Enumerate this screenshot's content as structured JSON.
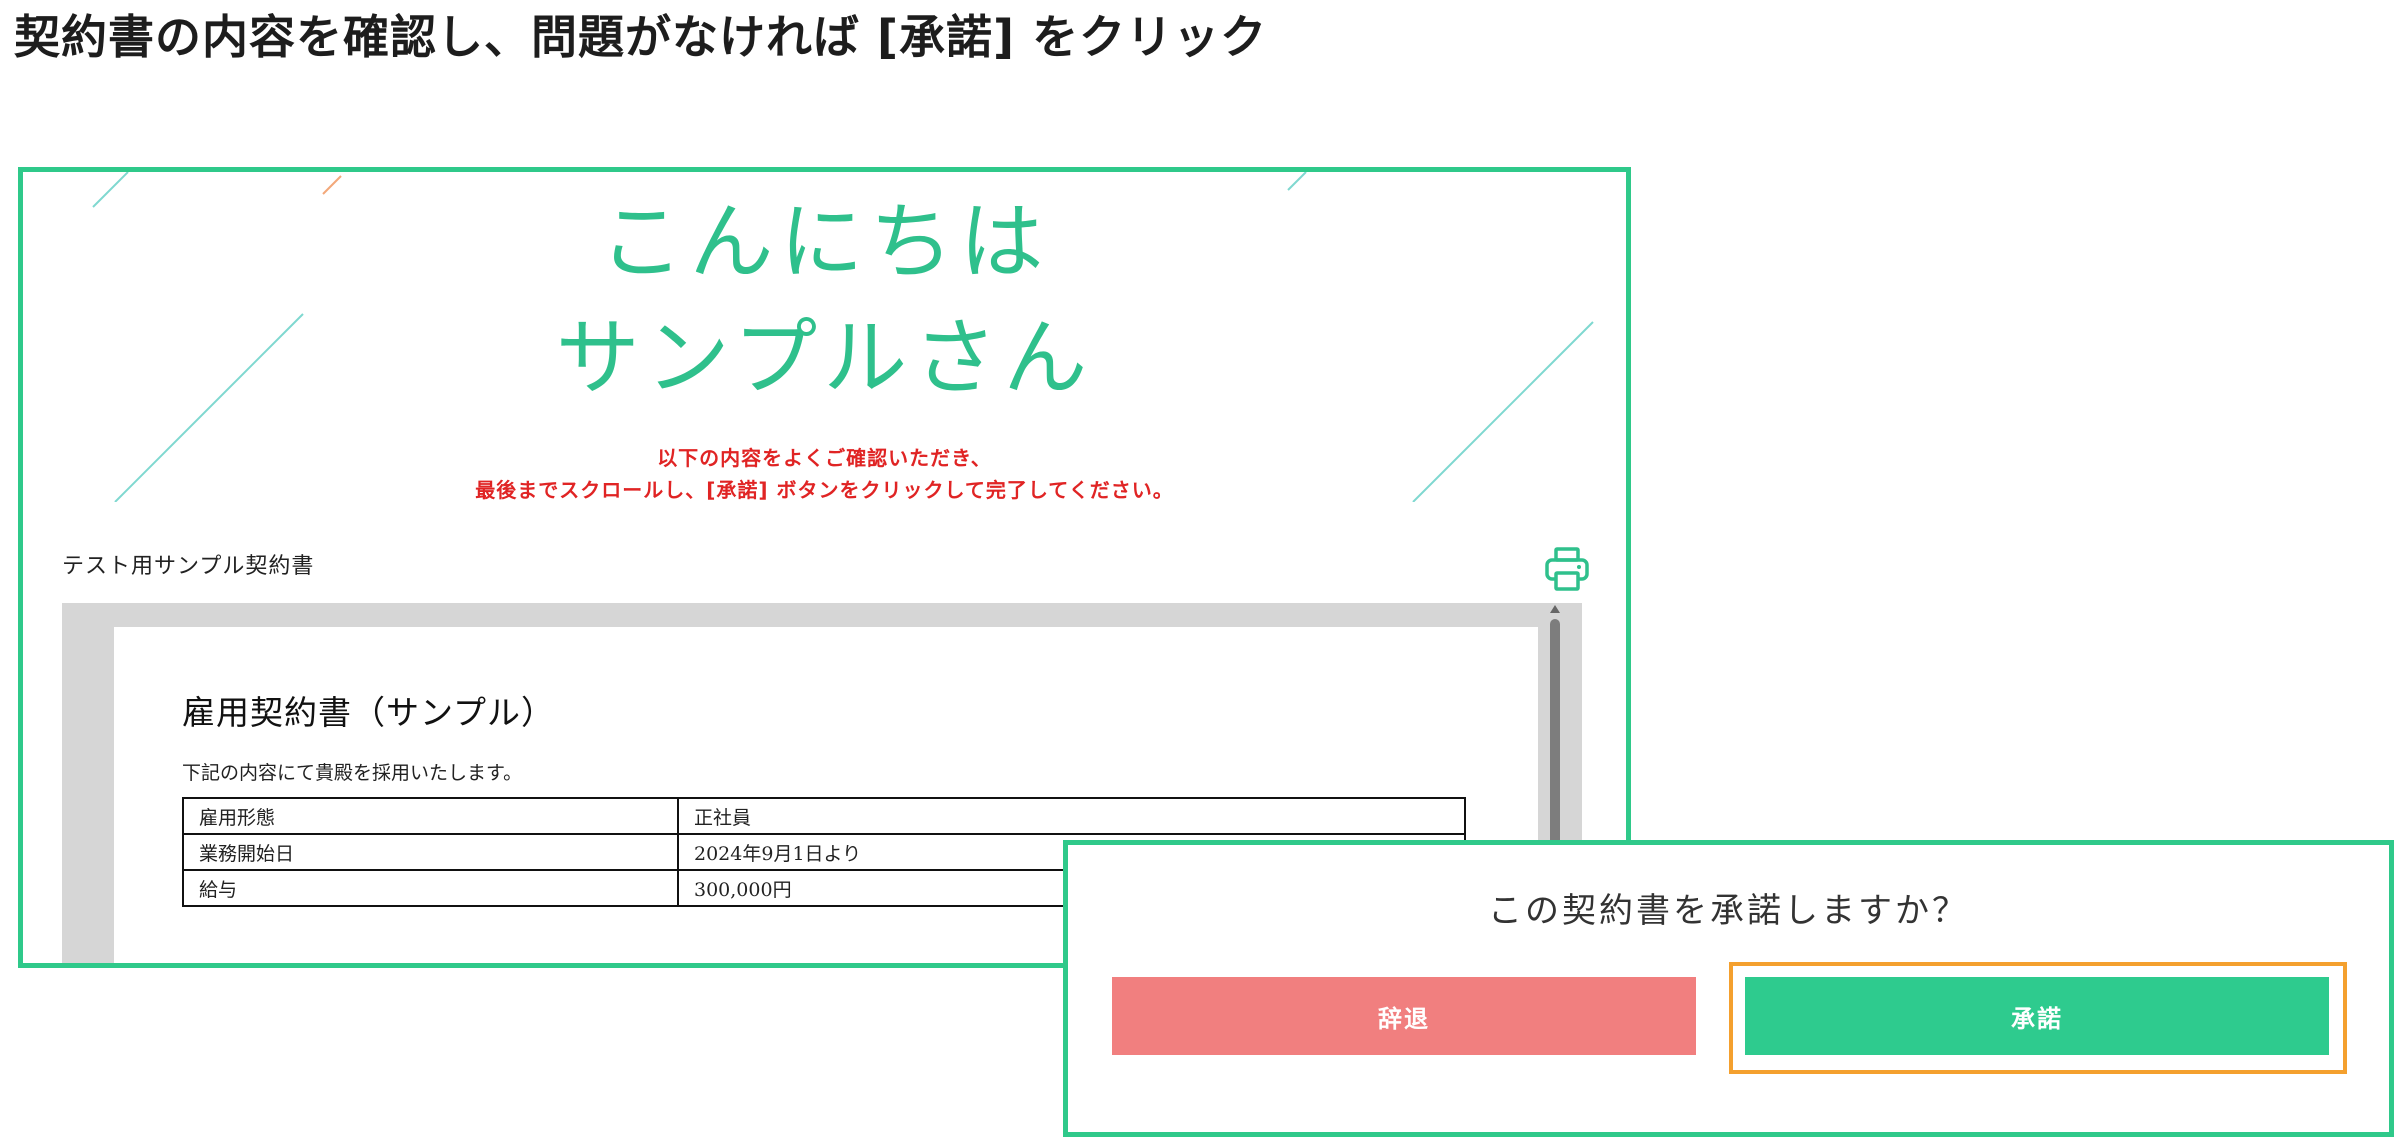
{
  "instruction": {
    "text": "契約書の内容を確認し、問題がなければ [承諾] をクリック"
  },
  "contract_screen": {
    "greeting_line1": "こんにちは",
    "greeting_line2": "サンプルさん",
    "notice_line1": "以下の内容をよくご確認いただき、",
    "notice_line2": "最後までスクロールし、[承諾] ボタンをクリックして完了してください。",
    "document_title": "テスト用サンプル契約書",
    "print_icon": "printer-icon",
    "document": {
      "title": "雇用契約書（サンプル）",
      "intro": "下記の内容にて貴殿を採用いたします。",
      "rows": [
        {
          "label": "雇用形態",
          "value": "正社員"
        },
        {
          "label": "業務開始日",
          "value": "2024年9月1日より"
        },
        {
          "label": "給与",
          "value": "300,000円"
        }
      ]
    }
  },
  "confirm_dialog": {
    "question": "この契約書を承諾しますか？",
    "decline_label": "辞退",
    "accept_label": "承諾"
  },
  "colors": {
    "brand_green": "#2fc98a",
    "greeting_green": "#2fc08c",
    "notice_red": "#e02424",
    "decline_red": "#f17f7f",
    "accept_green": "#2ecb8e",
    "highlight_orange": "#f4a02e"
  }
}
